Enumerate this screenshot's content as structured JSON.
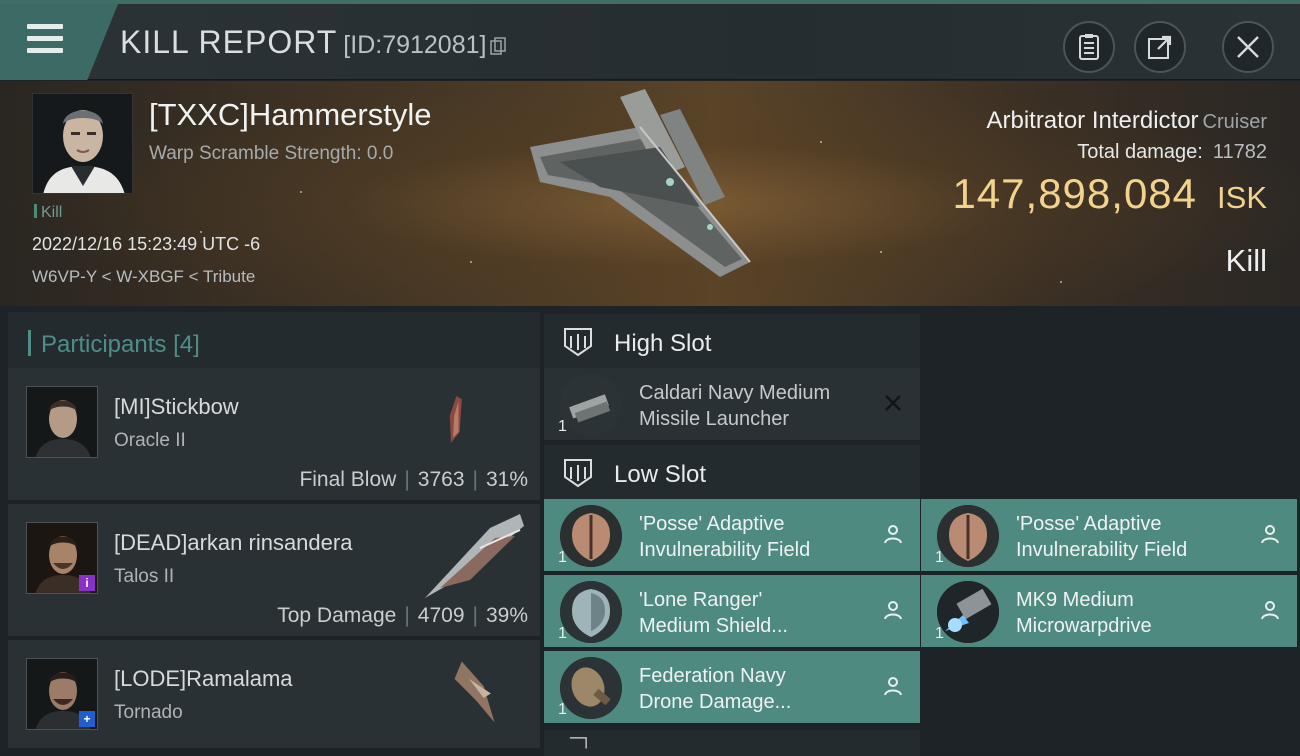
{
  "header": {
    "title": "KILL REPORT",
    "report_id": "[ID:7912081]",
    "icons": [
      "menu-icon",
      "clipboard-icon",
      "share-icon",
      "close-icon"
    ]
  },
  "victim": {
    "pilot_name": "[TXXC]Hammerstyle",
    "warp_scramble": "Warp Scramble Strength: 0.0",
    "kill_tag": "Kill",
    "datetime": "2022/12/16 15:23:49 UTC -6",
    "location": "W6VP-Y < W-XBGF < Tribute",
    "ship_name": "Arbitrator Interdictor",
    "ship_class": "Cruiser",
    "total_damage_label": "Total damage:",
    "total_damage_value": "11782",
    "isk_value": "147,898,084",
    "isk_unit": "ISK",
    "result": "Kill"
  },
  "participants": {
    "title": "Participants",
    "count": "[4]",
    "items": [
      {
        "name": "[MI]Stickbow",
        "ship": "Oracle II",
        "role": "Final Blow",
        "damage": "3763",
        "percent": "31%",
        "badge": ""
      },
      {
        "name": "[DEAD]arkan rinsandera",
        "ship": "Talos II",
        "role": "Top Damage",
        "damage": "4709",
        "percent": "39%",
        "badge": "purple"
      },
      {
        "name": "[LODE]Ramalama",
        "ship": "Tornado",
        "role": "",
        "damage": "",
        "percent": "",
        "badge": "blue"
      }
    ]
  },
  "slots": {
    "high": {
      "title": "High Slot",
      "modules": [
        {
          "name_line1": "Caldari Navy Medium",
          "name_line2": "Missile Launcher",
          "qty": "1",
          "state": "destroyed"
        }
      ]
    },
    "low": {
      "title": "Low Slot",
      "modules": [
        {
          "name_line1": "'Posse' Adaptive",
          "name_line2": "Invulnerability Field",
          "qty": "1",
          "state": "dropped"
        },
        {
          "name_line1": "'Posse' Adaptive",
          "name_line2": "Invulnerability Field",
          "qty": "1",
          "state": "dropped"
        },
        {
          "name_line1": "'Lone Ranger'",
          "name_line2": "Medium Shield...",
          "qty": "1",
          "state": "dropped"
        },
        {
          "name_line1": "MK9 Medium",
          "name_line2": "Microwarpdrive",
          "qty": "1",
          "state": "dropped"
        },
        {
          "name_line1": "Federation Navy",
          "name_line2": "Drone Damage...",
          "qty": "1",
          "state": "dropped"
        }
      ]
    }
  },
  "colors": {
    "accent": "#4e8a80",
    "isk_gold": "#f2d38e",
    "participants_title": "#4f8d86"
  }
}
